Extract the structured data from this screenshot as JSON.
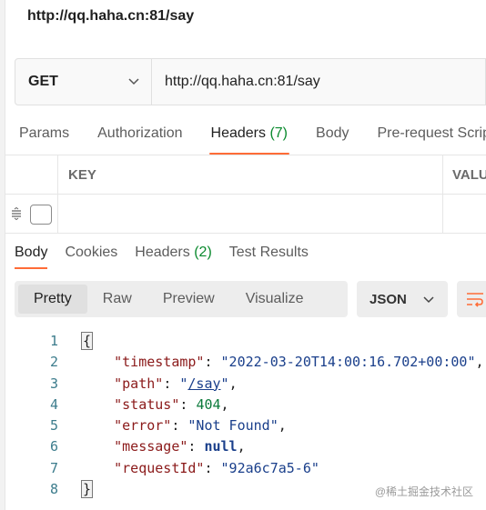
{
  "request": {
    "title": "http://qq.haha.cn:81/say",
    "method": "GET",
    "url": "http://qq.haha.cn:81/say"
  },
  "request_tabs": [
    {
      "label": "Params"
    },
    {
      "label": "Authorization"
    },
    {
      "label": "Headers",
      "count": "(7)"
    },
    {
      "label": "Body"
    },
    {
      "label": "Pre-request Script"
    }
  ],
  "headers_table": {
    "key_header": "KEY",
    "value_header": "VALUE"
  },
  "response_tabs": [
    {
      "label": "Body"
    },
    {
      "label": "Cookies"
    },
    {
      "label": "Headers",
      "count": "(2)"
    },
    {
      "label": "Test Results"
    }
  ],
  "view_modes": [
    "Pretty",
    "Raw",
    "Preview",
    "Visualize"
  ],
  "format": "JSON",
  "response_body": {
    "line_numbers": [
      "1",
      "2",
      "3",
      "4",
      "5",
      "6",
      "7",
      "8"
    ],
    "open_brace": "{",
    "close_brace": "}",
    "fields": [
      {
        "key": "\"timestamp\"",
        "value": "\"2022-03-20T14:00:16.702+00:00\""
      },
      {
        "key": "\"path\"",
        "value_pre": "\"",
        "value_link": "/say",
        "value_post": "\""
      },
      {
        "key": "\"status\"",
        "value": "404"
      },
      {
        "key": "\"error\"",
        "value": "\"Not Found\""
      },
      {
        "key": "\"message\"",
        "value": "null"
      },
      {
        "key": "\"requestId\"",
        "value": "\"92a6c7a5-6\""
      }
    ]
  },
  "watermark": "@稀土掘金技术社区",
  "colors": {
    "accent": "#ff6c37",
    "count_green": "#0a8a2e"
  }
}
